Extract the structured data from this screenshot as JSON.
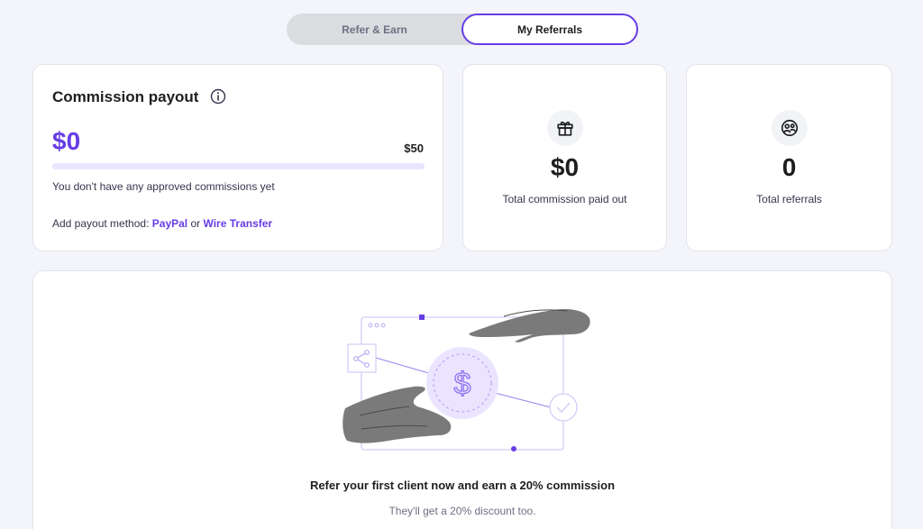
{
  "tabs": {
    "refer_earn": "Refer & Earn",
    "my_referrals": "My Referrals"
  },
  "payout": {
    "title": "Commission payout",
    "amount": "$0",
    "goal": "$50",
    "progress_fraction": 0,
    "empty_message": "You don't have any approved commissions yet",
    "add_method_prefix": "Add payout method:",
    "method_paypal": "PayPal",
    "method_or": "or",
    "method_wire": "Wire Transfer"
  },
  "stats": {
    "paid_value": "$0",
    "paid_label": "Total commission paid out",
    "referrals_value": "0",
    "referrals_label": "Total referrals"
  },
  "promo": {
    "title": "Refer your first client now and earn a 20% commission",
    "subtitle": "They'll get a 20% discount too."
  },
  "icons": {
    "info": "info-icon",
    "gift": "gift-icon",
    "referrals": "referrals-icon",
    "share": "share-icon",
    "dollar": "dollar-icon",
    "check": "check-icon"
  },
  "colors": {
    "accent": "#673de6",
    "accent_light": "#ebe4ff",
    "text_dark": "#1d1e20",
    "background": "#f4f4fb"
  }
}
